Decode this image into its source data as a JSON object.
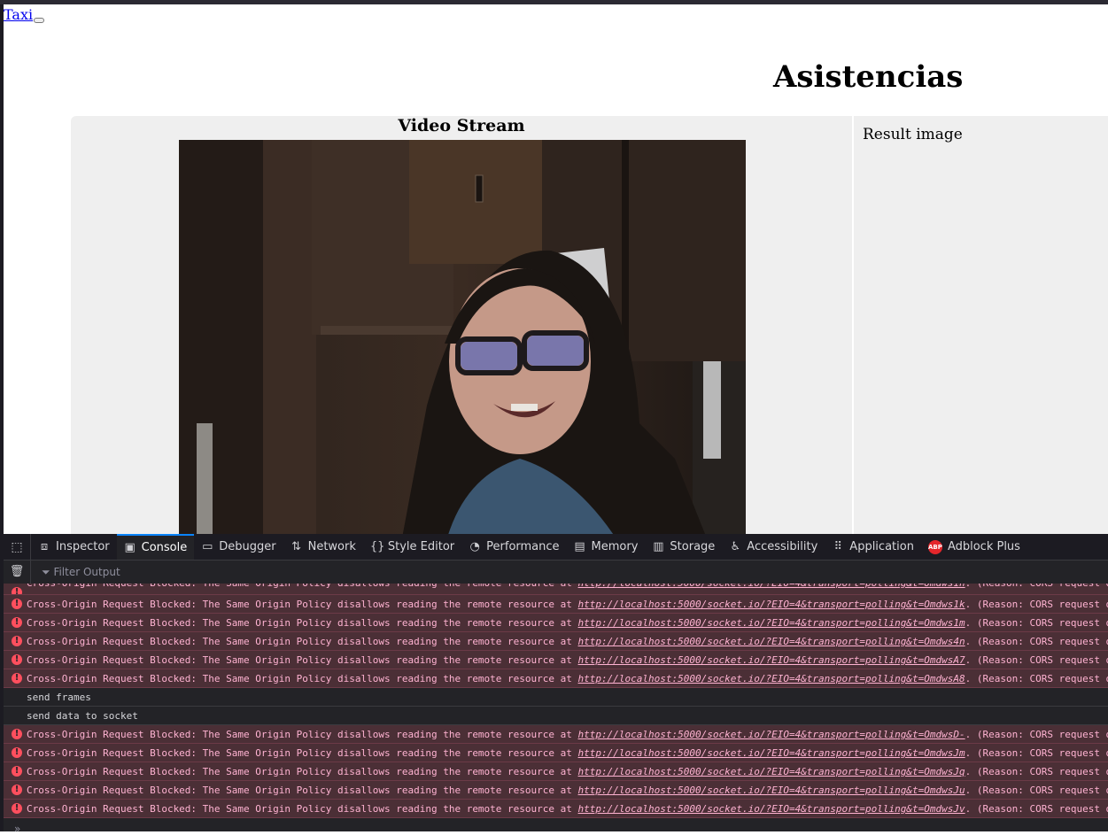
{
  "page": {
    "link_text": "Taxi",
    "heading": "Asistencias",
    "video_title": "Video Stream",
    "result_label": "Result image"
  },
  "devtools": {
    "tabs": [
      {
        "icon": "inspector-icon",
        "label": "Inspector"
      },
      {
        "icon": "console-icon",
        "label": "Console"
      },
      {
        "icon": "debugger-icon",
        "label": "Debugger"
      },
      {
        "icon": "network-icon",
        "label": "Network"
      },
      {
        "icon": "style-editor-icon",
        "label": "Style Editor"
      },
      {
        "icon": "performance-icon",
        "label": "Performance"
      },
      {
        "icon": "memory-icon",
        "label": "Memory"
      },
      {
        "icon": "storage-icon",
        "label": "Storage"
      },
      {
        "icon": "accessibility-icon",
        "label": "Accessibility"
      },
      {
        "icon": "application-icon",
        "label": "Application"
      },
      {
        "icon": "adblock-icon",
        "label": "Adblock Plus"
      }
    ],
    "active_tab": "Console",
    "filter_placeholder": "Filter Output",
    "error_prefix": "Cross-Origin Request Blocked: The Same Origin Policy disallows reading the remote resource at ",
    "error_suffix": ". (Reason: CORS request d",
    "messages": [
      {
        "type": "error",
        "url": "http://localhost:5000/socket.io/?EIO=4&transport=polling&t=Omdws1h"
      },
      {
        "type": "error",
        "url": "http://localhost:5000/socket.io/?EIO=4&transport=polling&t=Omdws1k"
      },
      {
        "type": "error",
        "url": "http://localhost:5000/socket.io/?EIO=4&transport=polling&t=Omdws1m"
      },
      {
        "type": "error",
        "url": "http://localhost:5000/socket.io/?EIO=4&transport=polling&t=Omdws4n"
      },
      {
        "type": "error",
        "url": "http://localhost:5000/socket.io/?EIO=4&transport=polling&t=OmdwsA7"
      },
      {
        "type": "error",
        "url": "http://localhost:5000/socket.io/?EIO=4&transport=polling&t=OmdwsA8"
      },
      {
        "type": "log",
        "text": "send frames"
      },
      {
        "type": "log",
        "text": "send data to socket"
      },
      {
        "type": "error",
        "url": "http://localhost:5000/socket.io/?EIO=4&transport=polling&t=OmdwsD-"
      },
      {
        "type": "error",
        "url": "http://localhost:5000/socket.io/?EIO=4&transport=polling&t=OmdwsJm"
      },
      {
        "type": "error",
        "url": "http://localhost:5000/socket.io/?EIO=4&transport=polling&t=OmdwsJq"
      },
      {
        "type": "error",
        "url": "http://localhost:5000/socket.io/?EIO=4&transport=polling&t=OmdwsJu"
      },
      {
        "type": "error",
        "url": "http://localhost:5000/socket.io/?EIO=4&transport=polling&t=OmdwsJv"
      }
    ],
    "prompt_symbol": "»"
  },
  "colors": {
    "devtools_bg": "#232327",
    "error_bg": "#4b2f36",
    "error_text": "#ffb3d2",
    "active_tab_accent": "#0a84ff",
    "link": "#0000ee"
  }
}
